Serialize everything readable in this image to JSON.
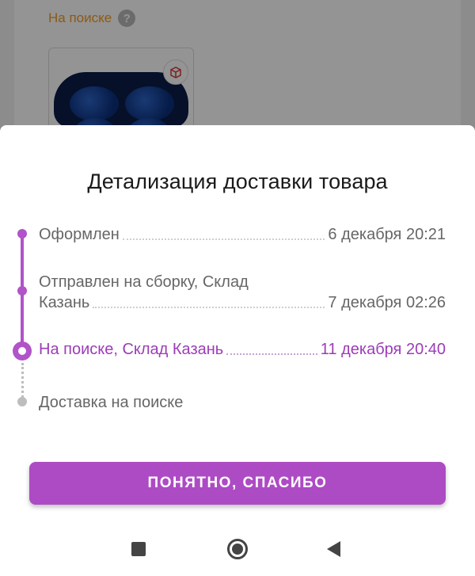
{
  "background": {
    "status_label": "На поиске",
    "help_icon": "question-mark-icon",
    "thumb_badge_icon": "box-return-icon"
  },
  "sheet": {
    "title": "Детализация доставки товара",
    "events": [
      {
        "label": "Оформлен",
        "date": "6 декабря 20:21",
        "state": "done"
      },
      {
        "label_line1": "Отправлен на сборку, Склад",
        "label_line2": "Казань",
        "date": "7 декабря 02:26",
        "state": "done"
      },
      {
        "label": "На поиске, Склад Казань",
        "date": "11 декабря 20:40",
        "state": "current"
      },
      {
        "label": "Доставка на поиске",
        "date": "",
        "state": "pending"
      }
    ],
    "button_label": "ПОНЯТНО, СПАСИБО"
  },
  "colors": {
    "accent": "#ad4bc4",
    "status_orange": "#f29b27",
    "pending_grey": "#bdbdbd"
  },
  "navbar": {
    "icons": [
      "recent-apps-icon",
      "home-icon",
      "back-icon"
    ]
  }
}
